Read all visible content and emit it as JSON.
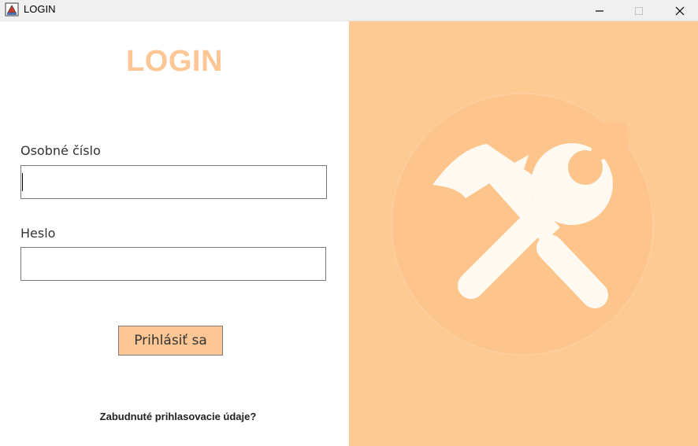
{
  "window": {
    "title": "LOGIN",
    "app_icon": "java-cup-icon",
    "controls": [
      "minimize-icon",
      "maximize-icon",
      "close-icon"
    ]
  },
  "login": {
    "heading": "LOGIN",
    "id_label": "Osobné číslo",
    "id_value": "",
    "password_label": "Heslo",
    "password_value": "",
    "submit_label": "Prihlásiť sa",
    "forgot_label": "Zabudnuté prihlasovacie údaje?"
  },
  "graphic": {
    "icon": "hammer-wrench-icon"
  },
  "colors": {
    "accent": "#fdc795",
    "panel": "#fdca94",
    "circle": "#fdc58c",
    "tools": "#fffaf1"
  }
}
